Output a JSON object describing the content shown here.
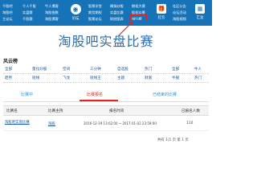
{
  "nav": {
    "col1": [
      "千股吧",
      "淘股吧",
      "主论坛"
    ],
    "col2": [
      "千人千股",
      "实盘赛",
      "千股赛"
    ],
    "col3": [
      "牛人博客",
      "淘股指数",
      "淘股博客"
    ],
    "center_icon_label": "论坛",
    "col4": [
      "股票学堂",
      "期货期权",
      "股票论坛"
    ],
    "col5": [
      "模拟炒股",
      "实盘比赛",
      "财经图表"
    ],
    "col6": [
      "期权大赛",
      "股权众筹",
      "排行榜"
    ],
    "gift_label": "红包",
    "col7": [
      "社区公告",
      "论坛活动",
      "淘股视频"
    ],
    "right_icon_label": "汇总",
    "col8": [
      "论坛精华",
      "论坛"
    ]
  },
  "page_title": "淘股吧实盘比赛",
  "group": {
    "title": "风云榜",
    "row1": [
      "全部",
      "量化炒股",
      "空间",
      "三分钟",
      "自选股",
      "热门",
      "全部",
      "牛人"
    ],
    "row2": [
      "趋势",
      "短线",
      "飞龙",
      "短线王",
      "主题",
      "财富",
      "牛股",
      "热门"
    ]
  },
  "tabs": [
    "比赛中",
    "比赛报名",
    "已结束的比赛"
  ],
  "table": {
    "headers": [
      "比赛名",
      "比赛主持",
      "报名时间",
      "已报名人数"
    ],
    "row": {
      "name": "淘股吧实盘比赛",
      "host": "淘股",
      "time": "2016-12-19 13:02:00 ~ 2017-01-02 23:59:00",
      "count": "110"
    }
  },
  "paging": "共有 1/1 页 第 1 页"
}
